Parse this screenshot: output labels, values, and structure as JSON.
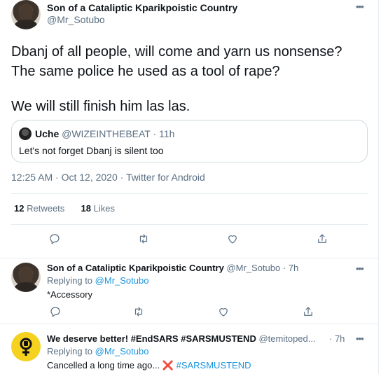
{
  "main_tweet": {
    "author_name": "Son of a Cataliptic Kparikpoistic Country",
    "author_handle": "@Mr_Sotubo",
    "text_lines": [
      "Dbanj of all people, will come and yarn us nonsense?",
      "The same police he used as a tool of rape?",
      "We will still finish him las las."
    ],
    "quote": {
      "name": "Uche",
      "handle": "@WIZEINTHEBEAT",
      "time": "· 11h",
      "text": "Let's not forget Dbanj is silent too"
    },
    "meta": "12:25 AM · Oct 12, 2020 · Twitter for Android",
    "retweets_count": "12",
    "retweets_label": "Retweets",
    "likes_count": "18",
    "likes_label": "Likes"
  },
  "replies": [
    {
      "author_name": "Son of a Cataliptic Kparikpoistic Country",
      "author_handle": "@Mr_Sotubo",
      "time": "· 7h",
      "replying_prefix": "Replying to",
      "replying_to": "@Mr_Sotubo",
      "text": "*Accessory"
    },
    {
      "author_name": "We deserve better! #EndSARS #SARSMUSTEND",
      "author_handle": "@temitoped...",
      "time": "· 7h",
      "replying_prefix": "Replying to",
      "replying_to": "@Mr_Sotubo",
      "text": "Cancelled a long time ago...",
      "cross": "❌",
      "hashtag": "#SARSMUSTEND"
    }
  ],
  "icons": {
    "more": "more-icon",
    "reply": "reply-icon",
    "retweet": "retweet-icon",
    "like": "like-icon",
    "share": "share-icon"
  },
  "colors": {
    "text": "#0f1419",
    "secondary": "#5b7083",
    "link": "#1b95e0",
    "border": "#e6ecf0",
    "avatar_yellow": "#f4d21f",
    "cross_red": "#e02d2d"
  }
}
